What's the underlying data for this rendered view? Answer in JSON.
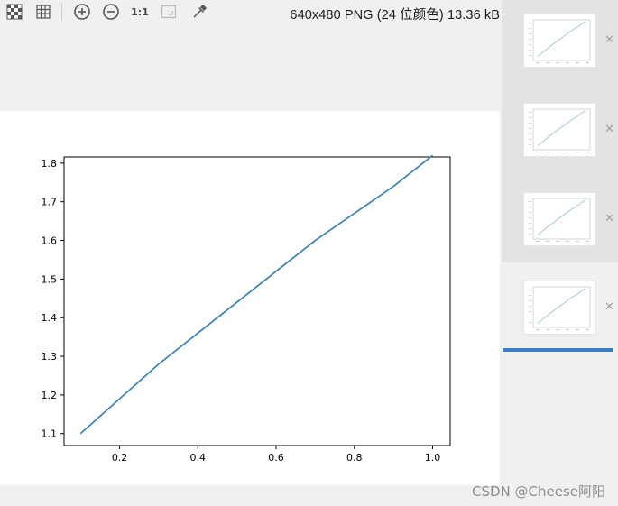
{
  "toolbar": {
    "info_text": "640x480 PNG (24 位颜色) 13.36 kB",
    "actual_size_label": "1:1",
    "icons": [
      "checker-transparency-icon",
      "grid-icon",
      "zoom-in-icon",
      "zoom-out-icon",
      "actual-size-icon",
      "fit-window-icon",
      "color-picker-icon"
    ]
  },
  "watermark": "CSDN @Cheese阿阳",
  "thumbnails": {
    "count": 4,
    "selected_index": 3
  },
  "colors": {
    "line": "#3682be",
    "accent": "#3a7fc1"
  },
  "chart_data": {
    "type": "line",
    "title": "",
    "xlabel": "",
    "ylabel": "",
    "x": [
      0.1,
      0.2,
      0.3,
      0.4,
      0.5,
      0.6,
      0.7,
      0.8,
      0.9,
      1.0
    ],
    "series": [
      {
        "values": [
          1.1,
          1.19,
          1.28,
          1.36,
          1.44,
          1.52,
          1.6,
          1.67,
          1.74,
          1.82
        ]
      }
    ],
    "xlim": [
      0.058,
      1.045
    ],
    "ylim": [
      1.069,
      1.816
    ],
    "xticks": [
      0.2,
      0.4,
      0.6,
      0.8,
      1.0
    ],
    "xtick_labels": [
      "0.2",
      "0.4",
      "0.6",
      "0.8",
      "1.0"
    ],
    "yticks": [
      1.1,
      1.2,
      1.3,
      1.4,
      1.5,
      1.6,
      1.7,
      1.8
    ],
    "ytick_labels": [
      "1.1",
      "1.2",
      "1.3",
      "1.4",
      "1.5",
      "1.6",
      "1.7",
      "1.8"
    ],
    "grid": false
  }
}
